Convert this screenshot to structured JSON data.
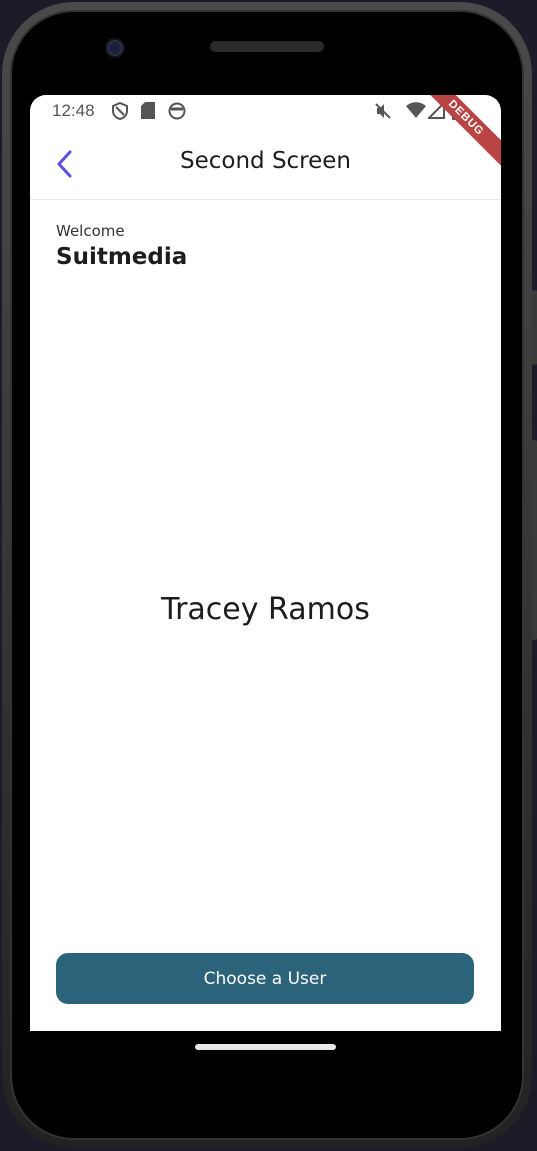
{
  "status_bar": {
    "time": "12:48",
    "left_icons": [
      "shield-icon",
      "sd-card-icon",
      "face-icon"
    ],
    "right_icons": [
      "mute-icon",
      "wifi-icon",
      "signal-icon",
      "battery-icon"
    ]
  },
  "debug_banner": "DEBUG",
  "app_bar": {
    "title": "Second Screen",
    "back_icon": "chevron-left-icon"
  },
  "content": {
    "welcome_label": "Welcome",
    "user_name": "Suitmedia",
    "selected_user": "Tracey Ramos"
  },
  "actions": {
    "choose_user_label": "Choose a User"
  },
  "colors": {
    "accent": "#5b4fe0",
    "button": "#2b637a",
    "debug_banner": "#b84444"
  }
}
